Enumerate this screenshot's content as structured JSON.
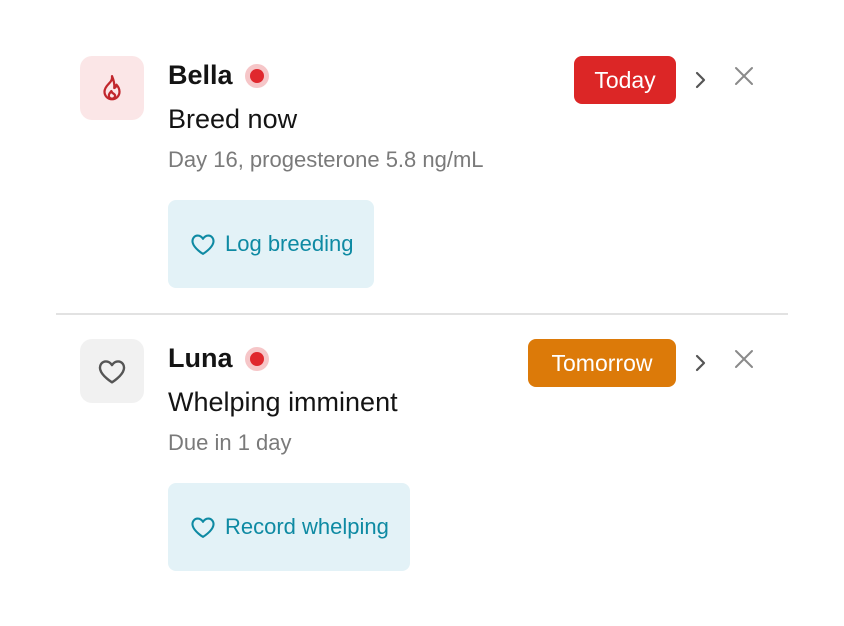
{
  "alerts": [
    {
      "name": "Bella",
      "title": "Breed now",
      "subtitle": "Day 16, progesterone 5.8 ng/mL",
      "icon": "flame-icon",
      "icon_color": "#c1272d",
      "icon_bg": "#fbe6e7",
      "status_dot_color": "#e0282e",
      "badge_label": "Today",
      "badge_color": "#dc2626",
      "action_label": "Log breeding",
      "action_icon": "heart-icon"
    },
    {
      "name": "Luna",
      "title": "Whelping imminent",
      "subtitle": "Due in 1 day",
      "icon": "heart-icon",
      "icon_color": "#555555",
      "icon_bg": "#f1f1f1",
      "status_dot_color": "#e0282e",
      "badge_label": "Tomorrow",
      "badge_color": "#dc7a09",
      "action_label": "Record whelping",
      "action_icon": "heart-icon"
    }
  ],
  "colors": {
    "action_bg": "#e3f2f7",
    "action_text": "#0e8aa3",
    "divider": "#e2e2e2",
    "muted_icon": "#8a8a8a"
  }
}
